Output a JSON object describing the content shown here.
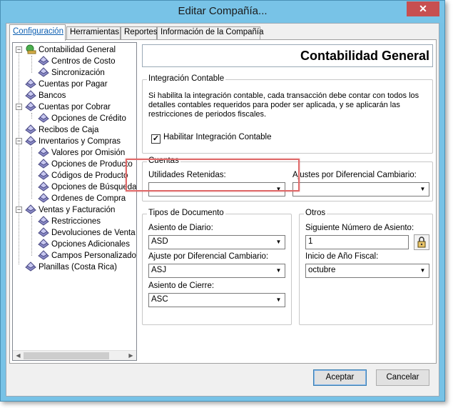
{
  "window": {
    "title": "Editar Compañía...",
    "close_label": "✕"
  },
  "tabs": [
    {
      "label": "Configuración"
    },
    {
      "label": "Herramientas"
    },
    {
      "label": "Reportes"
    },
    {
      "label": "Información de la Compañía"
    }
  ],
  "tree": {
    "items": [
      {
        "label": "Contabilidad General",
        "icon": "accounting-globe-icon"
      },
      {
        "label": "Centros de Costo",
        "icon": "module-icon"
      },
      {
        "label": "Sincronización",
        "icon": "module-icon"
      },
      {
        "label": "Cuentas por Pagar",
        "icon": "module-icon"
      },
      {
        "label": "Bancos",
        "icon": "module-icon"
      },
      {
        "label": "Cuentas por Cobrar",
        "icon": "module-icon"
      },
      {
        "label": "Opciones de Crédito",
        "icon": "module-icon"
      },
      {
        "label": "Recibos de Caja",
        "icon": "module-icon"
      },
      {
        "label": "Inventarios y Compras",
        "icon": "module-icon"
      },
      {
        "label": "Valores por Omisión",
        "icon": "module-icon"
      },
      {
        "label": "Opciones de Producto",
        "icon": "module-icon"
      },
      {
        "label": "Códigos de Producto",
        "icon": "module-icon"
      },
      {
        "label": "Opciones de Búsqueda",
        "icon": "module-icon"
      },
      {
        "label": "Ordenes de Compra",
        "icon": "module-icon"
      },
      {
        "label": "Ventas y Facturación",
        "icon": "module-icon"
      },
      {
        "label": "Restricciones",
        "icon": "module-icon"
      },
      {
        "label": "Devoluciones de Venta",
        "icon": "module-icon"
      },
      {
        "label": "Opciones Adicionales",
        "icon": "module-icon"
      },
      {
        "label": "Campos Personalizados",
        "icon": "module-icon"
      },
      {
        "label": "Planillas (Costa Rica)",
        "icon": "module-icon"
      }
    ]
  },
  "panel": {
    "title": "Contabilidad General",
    "integration": {
      "group_label": "Integración Contable",
      "description": "Si habilita la integración contable, cada transacción debe contar con todos los detalles contables requeridos para poder ser aplicada, y se aplicarán las restricciones de periodos fiscales.",
      "checkbox_label": "Habilitar Integración Contable",
      "checked": true
    },
    "cuentas": {
      "group_label": "Cuentas",
      "utilidades_label": "Utilidades Retenidas:",
      "utilidades_value": "",
      "ajustes_label": "Ajustes por Diferencial Cambiario:",
      "ajustes_value": ""
    },
    "tipos": {
      "group_label": "Tipos de Documento",
      "diario_label": "Asiento de Diario:",
      "diario_value": "ASD",
      "ajuste_label": "Ajuste por Diferencial Cambiario:",
      "ajuste_value": "ASJ",
      "cierre_label": "Asiento de Cierre:",
      "cierre_value": "ASC"
    },
    "otros": {
      "group_label": "Otros",
      "siguiente_label": "Siguiente Número de Asiento:",
      "siguiente_value": "1",
      "inicio_label": "Inicio de Año Fiscal:",
      "inicio_value": "octubre"
    }
  },
  "buttons": {
    "accept": "Aceptar",
    "cancel": "Cancelar"
  },
  "colors": {
    "titlebar": "#78c3e7",
    "close": "#c74f50",
    "highlight": "#e06a6a",
    "active_tab": "#0b5eb1"
  }
}
